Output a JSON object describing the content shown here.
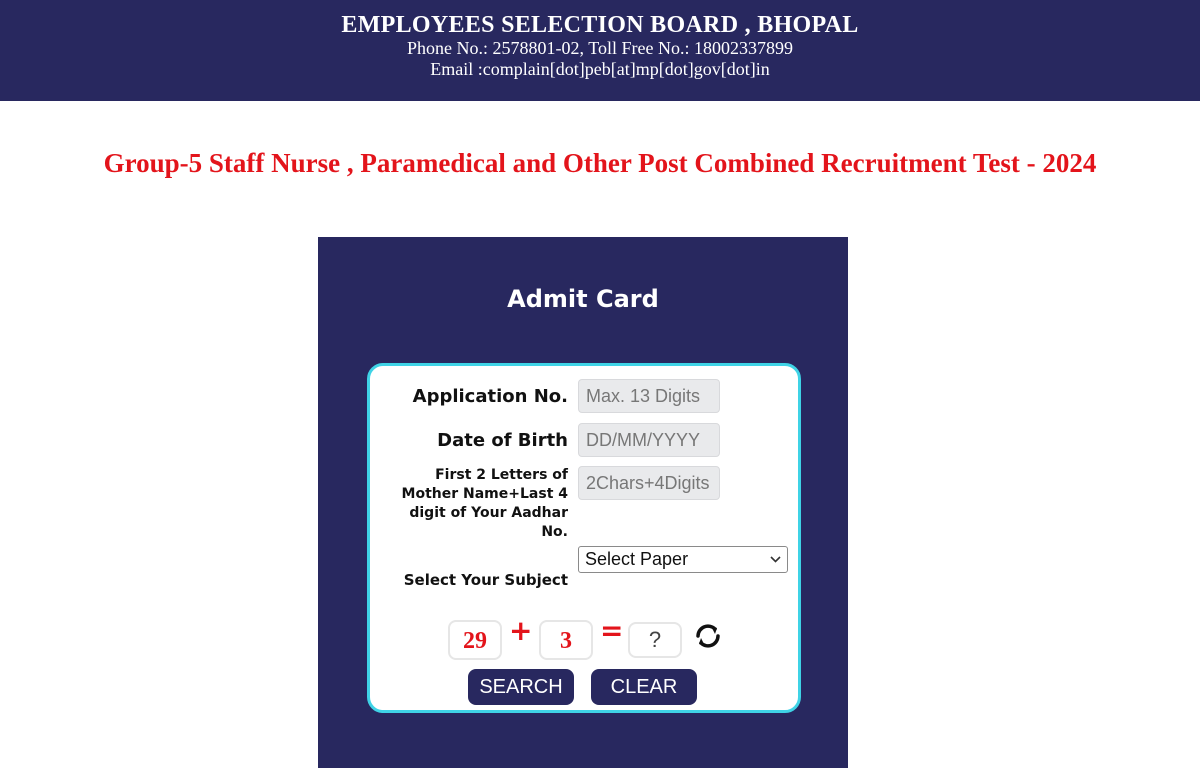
{
  "header": {
    "org_name": "EMPLOYEES SELECTION BOARD , BHOPAL",
    "phone": "Phone No.: 2578801-02, Toll Free No.: 18002337899",
    "email": "Email :complain[dot]peb[at]mp[dot]gov[dot]in"
  },
  "exam_title": "Group-5 Staff Nurse , Paramedical and Other Post Combined Recruitment Test - 2024",
  "panel": {
    "title": "Admit Card"
  },
  "form": {
    "application_label": "Application No.",
    "application_placeholder": "Max. 13 Digits",
    "dob_label": "Date of Birth",
    "dob_placeholder": "DD/MM/YYYY",
    "mother_label": "First 2 Letters of Mother Name+Last 4 digit of Your Aadhar No.",
    "mother_placeholder": "2Chars+4Digits",
    "subject_label": "Select Your Subject",
    "subject_selected": "Select Paper"
  },
  "captcha": {
    "num1": "29",
    "op": "+",
    "num2": "3",
    "equals": "=",
    "answer_placeholder": "?"
  },
  "buttons": {
    "search": "SEARCH",
    "clear": "CLEAR"
  },
  "colors": {
    "navy": "#28285f",
    "red": "#e3141b",
    "cyan_border": "#3fd3e6"
  }
}
